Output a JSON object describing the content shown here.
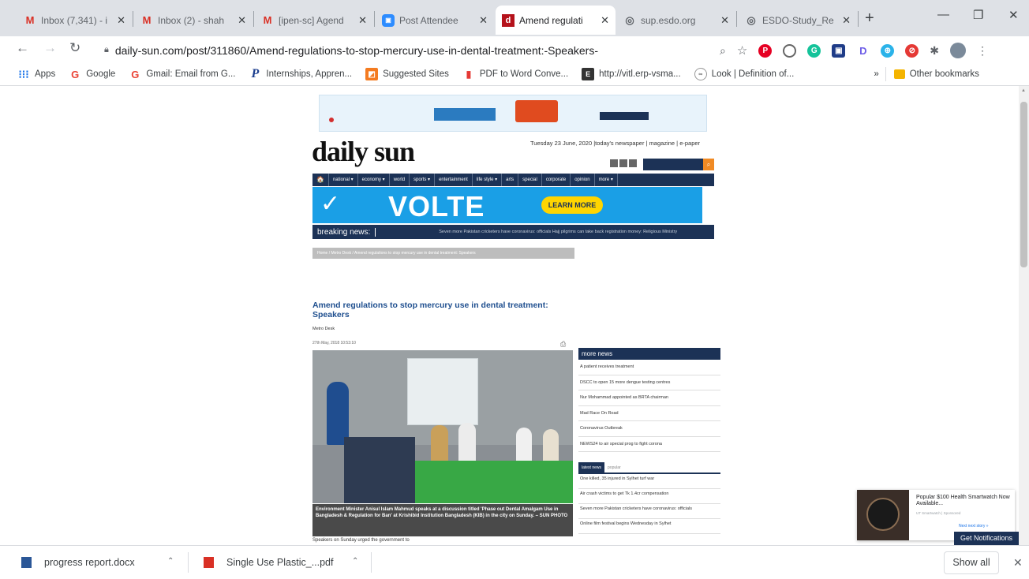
{
  "tabs": [
    {
      "title": "Inbox (7,341) - i",
      "icon": "gmail-icon"
    },
    {
      "title": "Inbox (2) - shah",
      "icon": "gmail-icon"
    },
    {
      "title": "[ipen-sc] Agend",
      "icon": "gmail-icon"
    },
    {
      "title": "Post Attendee",
      "icon": "zoom-icon"
    },
    {
      "title": "Amend regulati",
      "icon": "dailysun-icon"
    },
    {
      "title": "sup.esdo.org",
      "icon": "globe-icon"
    },
    {
      "title": "ESDO-Study_Re",
      "icon": "globe-icon"
    }
  ],
  "address": {
    "url": "daily-sun.com/post/311860/Amend-regulations-to-stop-mercury-use-in-dental-treatment:-Speakers-"
  },
  "bookmarks": [
    {
      "label": "Apps",
      "icon": "apps-grid-icon"
    },
    {
      "label": "Google",
      "icon": "google-icon"
    },
    {
      "label": "Gmail: Email from G...",
      "icon": "google-icon"
    },
    {
      "label": "Internships, Appren...",
      "icon": "p-logo-icon"
    },
    {
      "label": "Suggested Sites",
      "icon": "suggested-icon"
    },
    {
      "label": "PDF to Word Conve...",
      "icon": "pdf-icon"
    },
    {
      "label": "http://vitl.erp-vsma...",
      "icon": "site-icon"
    },
    {
      "label": "Look | Definition of...",
      "icon": "dictionary-icon"
    }
  ],
  "bookmarks_more": "»",
  "other_bookmarks": "Other bookmarks",
  "page": {
    "logo": "daily sun",
    "dateline": "Tuesday 23 June, 2020   |today's newspaper  | magazine  | e-paper",
    "nav": [
      "🏠",
      "national ▾",
      "economy ▾",
      "world",
      "sports ▾",
      "entertainment",
      "life style ▾",
      "arts",
      "special",
      "corporate",
      "opinion",
      "more ▾"
    ],
    "volte_text": "VOLTE",
    "volte_btn": "LEARN MORE",
    "breaking_label": "breaking news:",
    "breaking_text": "Seven more Pakistan cricketers have coronavirus: officials     Hajj pilgrims can take back registration money: Religious Ministry",
    "breadcrumb": "Home  /  Metro Desk  /  Amend regulations to stop mercury use in dental treatment: Speakers",
    "headline": "Amend regulations to stop mercury use in dental treatment: Speakers",
    "byline": "Metro Desk",
    "date": "27th May, 2018 10:53:10",
    "caption": "Environment Minister Anisul Islam Mahmud speaks at a discussion titled 'Phase out Dental Amalgam Use in Bangladesh & Regulation for Ban' at Krishibid Institution Bangladesh (KIB) in the city on Sunday. – SUN PHOTO",
    "para": "Speakers on Sunday urged the government to",
    "more_news_title": "more news",
    "more_news": [
      "A patient receives treatment",
      "DSCC to open 15 more dengue testing centres",
      "Nur Mohammad appointed as BRTA chairman",
      "Mad Race On Road",
      "Coronavirus Outbreak",
      "NEWS24 to air special prog to fight corona"
    ],
    "latest_tab": "latest news",
    "popular_tab": "popular",
    "latest": [
      "One killed, 35 injured in Sylhet turf war",
      "Air crash victims to get Tk 1.4cr compensation",
      "Seven more Pakistan cricketers have coronavirus: officials",
      "Online film festival begins Wednesday in Sylhet"
    ]
  },
  "notification": {
    "title": "Popular $100 Health Smartwatch Now Available...",
    "source": "UT Smartwatch | Sponsored",
    "next": "Next next story »",
    "button": "Get Notifications"
  },
  "downloads": [
    {
      "name": "progress report.docx",
      "icon": "word-doc-icon",
      "color": "#2b5797"
    },
    {
      "name": "Single Use Plastic_...pdf",
      "icon": "pdf-file-icon",
      "color": "#d93025"
    }
  ],
  "show_all": "Show all"
}
